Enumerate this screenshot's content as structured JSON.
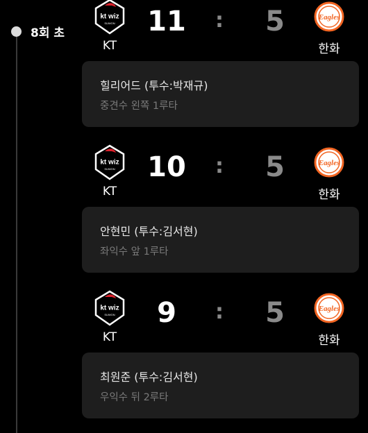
{
  "inning": {
    "label": "8회 초"
  },
  "colors": {
    "background": "#000000",
    "card": "#1e1e1e",
    "home_score": "#ffffff",
    "away_score": "#8a8a8a",
    "eagles_orange": "#f26522",
    "kt_red": "#d8202a"
  },
  "plays": [
    {
      "home_team": {
        "name": "KT",
        "logo": "kt-wiz-logo"
      },
      "away_team": {
        "name": "한화",
        "logo": "eagles-logo"
      },
      "home_score": "11",
      "separator": ":",
      "away_score": "5",
      "batter": "힐리어드 (투수:박재규)",
      "result": "중견수 왼쪽 1루타"
    },
    {
      "home_team": {
        "name": "KT",
        "logo": "kt-wiz-logo"
      },
      "away_team": {
        "name": "한화",
        "logo": "eagles-logo"
      },
      "home_score": "10",
      "separator": ":",
      "away_score": "5",
      "batter": "안현민 (투수:김서현)",
      "result": "좌익수 앞 1루타"
    },
    {
      "home_team": {
        "name": "KT",
        "logo": "kt-wiz-logo"
      },
      "away_team": {
        "name": "한화",
        "logo": "eagles-logo"
      },
      "home_score": "9",
      "separator": ":",
      "away_score": "5",
      "batter": "최원준 (투수:김서현)",
      "result": "우익수 뒤 2루타"
    }
  ]
}
